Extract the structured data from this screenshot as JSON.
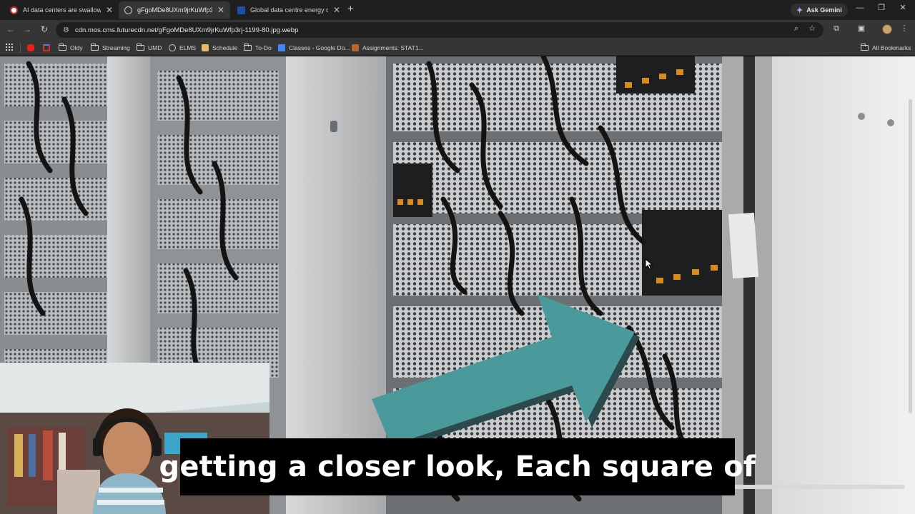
{
  "browser": {
    "tabs": [
      {
        "title": "AI data centers are swallowing",
        "icon": "site-favicon-icon",
        "active": false
      },
      {
        "title": "gFgoMDe8UXm9jrKuWfp3rj-11",
        "icon": "globe-icon",
        "active": true
      },
      {
        "title": "Global data centre energy dem",
        "icon": "site-favicon-icon",
        "active": false
      }
    ],
    "new_tab_label": "+",
    "ask_gemini_label": "Ask Gemini",
    "url": "cdn.mos.cms.futurecdn.net/gFgoMDe8UXm9jrKuWfp3rj-1199-80.jpg.webp"
  },
  "bookmarks": {
    "items": [
      {
        "label": "Oldy",
        "icon": "folder-icon"
      },
      {
        "label": "Streaming",
        "icon": "folder-icon"
      },
      {
        "label": "UMD",
        "icon": "folder-icon"
      },
      {
        "label": "ELMS",
        "icon": "elms-icon"
      },
      {
        "label": "Schedule",
        "icon": "schedule-icon"
      },
      {
        "label": "To-Do",
        "icon": "folder-icon"
      },
      {
        "label": "Classes - Google Do...",
        "icon": "google-docs-icon"
      },
      {
        "label": "Assignments: STAT1...",
        "icon": "assignments-icon"
      }
    ],
    "all_bookmarks_label": "All Bookmarks"
  },
  "overlay": {
    "caption": "getting a closer look, Each square of",
    "arrow_color": "#4a9a9c"
  },
  "colors": {
    "tabstrip": "#1f1f1f",
    "toolbar": "#353535",
    "omnibox": "#1f1f1f",
    "caption_bg": "#000000"
  }
}
